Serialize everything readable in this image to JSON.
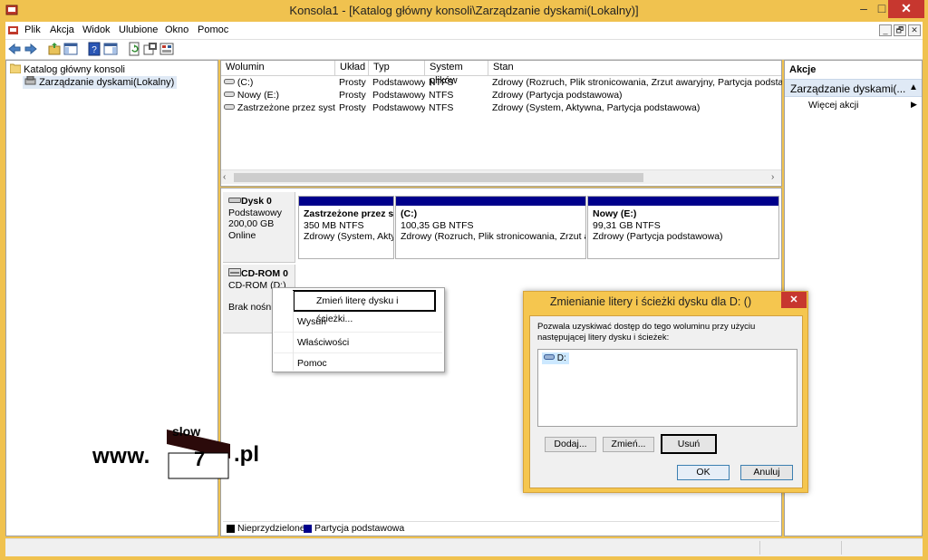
{
  "window": {
    "title": "Konsola1 - [Katalog główny konsoli\\Zarządzanie dyskami(Lokalny)]",
    "minimize": "–",
    "maximize": "□",
    "close": "✕"
  },
  "menu": {
    "items": [
      "Plik",
      "Akcja",
      "Widok",
      "Ulubione",
      "Okno",
      "Pomoc"
    ],
    "mdi_buttons": [
      "_",
      "🗗",
      "✕"
    ]
  },
  "tree": {
    "root": "Katalog główny konsoli",
    "child": "Zarządzanie dyskami(Lokalny)"
  },
  "volumes": {
    "columns": [
      "Wolumin",
      "Układ",
      "Typ",
      "System plików",
      "Stan"
    ],
    "rows": [
      [
        "(C:)",
        "Prosty",
        "Podstawowy",
        "NTFS",
        "Zdrowy (Rozruch, Plik stronicowania, Zrzut awaryjny, Partycja podstawowa)"
      ],
      [
        "Nowy (E:)",
        "Prosty",
        "Podstawowy",
        "NTFS",
        "Zdrowy (Partycja podstawowa)"
      ],
      [
        "Zastrzeżone przez system",
        "Prosty",
        "Podstawowy",
        "NTFS",
        "Zdrowy (System, Aktywna, Partycja podstawowa)"
      ]
    ]
  },
  "disks": {
    "disk0": {
      "name": "Dysk 0",
      "type": "Podstawowy",
      "size": "200,00 GB",
      "status": "Online",
      "partitions": [
        {
          "name": "Zastrzeżone przez sys",
          "size": "350 MB NTFS",
          "status": "Zdrowy (System, Aktyw"
        },
        {
          "name": "(C:)",
          "size": "100,35 GB NTFS",
          "status": "Zdrowy (Rozruch, Plik stronicowania, Zrzut awa"
        },
        {
          "name": "Nowy  (E:)",
          "size": "99,31 GB NTFS",
          "status": "Zdrowy (Partycja podstawowa)"
        }
      ]
    },
    "cdrom": {
      "name": "CD-ROM 0",
      "drive": "CD-ROM (D:)",
      "status": "Brak nośnik"
    }
  },
  "legend": {
    "unallocated": "Nieprzydzielone",
    "primary": "Partycja podstawowa"
  },
  "actions": {
    "header": "Akcje",
    "section": "Zarządzanie dyskami(...",
    "more": "Więcej akcji"
  },
  "context_menu": {
    "items": [
      "Zmień literę dysku i ścieżki...",
      "Wysuń",
      "Właściwości",
      "Pomoc"
    ]
  },
  "dialog": {
    "title": "Zmienianie litery i ścieżki dysku dla D: ()",
    "description": "Pozwala uzyskiwać dostęp do tego woluminu przy użyciu następującej litery dysku i ścieżek:",
    "list_item": "D:",
    "add": "Dodaj...",
    "change": "Zmień...",
    "remove": "Usuń",
    "ok": "OK",
    "cancel": "Anuluj"
  },
  "watermark": {
    "prefix": "www.",
    "top": "slow",
    "number": "7",
    "suffix": ".pl"
  },
  "colors": {
    "frame": "#f0c24f",
    "primary_partition": "#00008b",
    "unallocated": "#000000",
    "selection": "#cce8ff"
  },
  "icons": {
    "app": "console-icon",
    "back": "arrow-left-icon",
    "forward": "arrow-right-icon",
    "disk": "hard-disk-icon",
    "cd": "cd-rom-icon"
  }
}
